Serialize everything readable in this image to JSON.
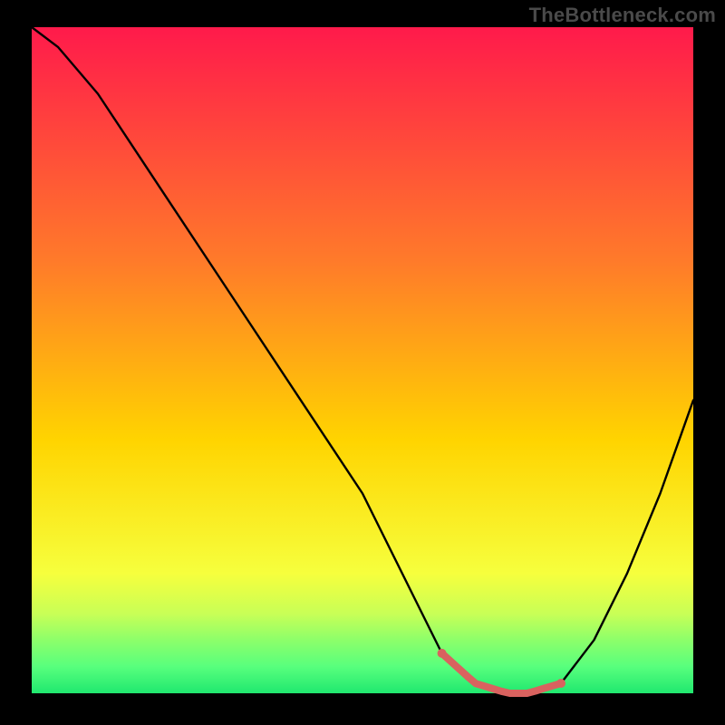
{
  "watermark": "TheBottleneck.com",
  "colors": {
    "black": "#000000",
    "curve": "#000000",
    "accent": "#d9625f",
    "grad_top": "#ff1a4b",
    "grad_upper_mid": "#ff7a2a",
    "grad_mid": "#ffd400",
    "grad_low1": "#f6ff3d",
    "grad_low2": "#c9ff56",
    "grad_low3": "#8dff6a",
    "grad_low4": "#58ff7d",
    "grad_bottom": "#20e86f"
  },
  "plot": {
    "inner_x": 35,
    "inner_y": 30,
    "inner_w": 730,
    "inner_h": 735
  },
  "chart_data": {
    "type": "line",
    "title": "",
    "xlabel": "",
    "ylabel": "",
    "xlim": [
      0,
      100
    ],
    "ylim": [
      0,
      100
    ],
    "grid": false,
    "series": [
      {
        "name": "bottleneck-curve",
        "x": [
          0,
          4,
          10,
          20,
          30,
          40,
          50,
          58,
          62,
          67,
          72,
          75,
          80,
          85,
          90,
          95,
          100
        ],
        "values": [
          100,
          97,
          90,
          75,
          60,
          45,
          30,
          14,
          6,
          1.5,
          0,
          0,
          1.5,
          8,
          18,
          30,
          44
        ]
      }
    ],
    "accent_region": {
      "name": "flat-bottom-highlight",
      "x_start": 62,
      "x_end": 80,
      "y": 0
    }
  }
}
